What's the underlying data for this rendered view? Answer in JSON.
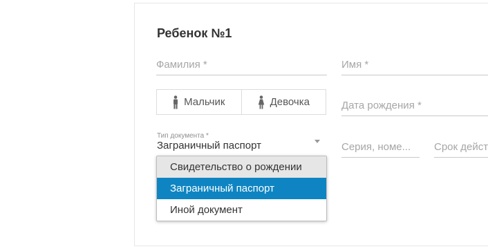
{
  "child": {
    "title": "Ребенок №1",
    "surname_placeholder": "Фамилия *",
    "name_placeholder": "Имя *",
    "gender": {
      "male": "Мальчик",
      "female": "Девочка"
    },
    "birthdate_placeholder": "Дата рождения *",
    "document_type": {
      "label": "Тип документа *",
      "value": "Заграничный паспорт",
      "options": [
        "Свидетельство о рождении",
        "Заграничный паспорт",
        "Иной документ"
      ]
    },
    "series_placeholder": "Серия, номе...",
    "expiry_placeholder": "Срок действ"
  },
  "colors": {
    "accent": "#0e85c2",
    "hover": "#e6e6e6"
  }
}
